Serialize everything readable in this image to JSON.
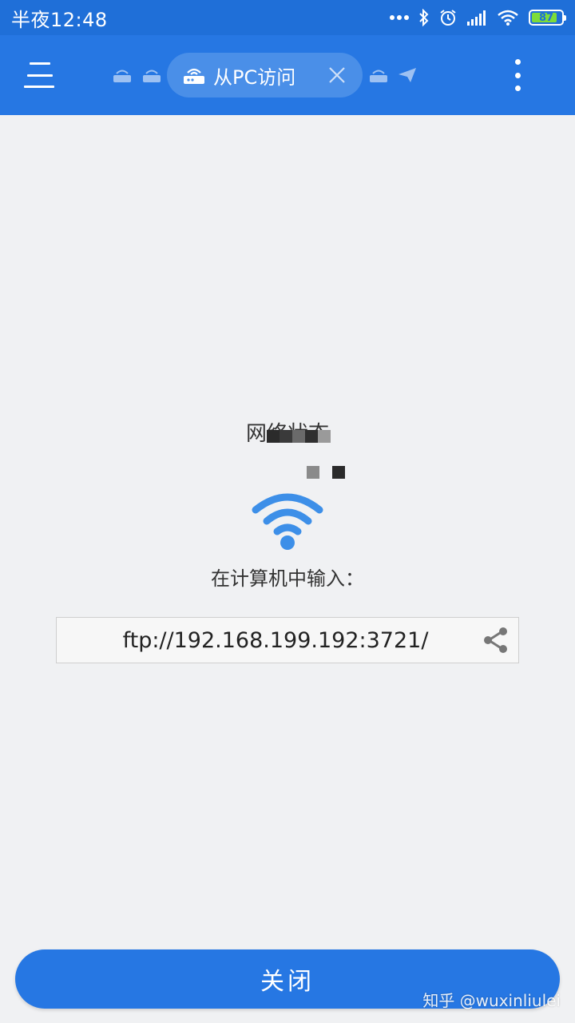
{
  "status_bar": {
    "time": "半夜12:48",
    "battery": "87",
    "battery_level": 0.87
  },
  "app_bar": {
    "active_tab_label": "从PC访问",
    "icons": {
      "menu": "menu-icon",
      "router": "router-icon",
      "send": "send-icon",
      "close": "close-icon",
      "more": "more-vert-icon"
    }
  },
  "content": {
    "network_status": "网络状态",
    "instruction": "在计算机中输入：",
    "url": "ftp://192.168.199.192:3721/"
  },
  "footer": {
    "close_label": "关闭",
    "watermark": "知乎 @wuxinliulei"
  },
  "colors": {
    "status_bar": "#1f6fd8",
    "app_bar": "#2677e3",
    "accent": "#2677e3",
    "wifi": "#3d8fe8",
    "background": "#f0f1f3"
  }
}
